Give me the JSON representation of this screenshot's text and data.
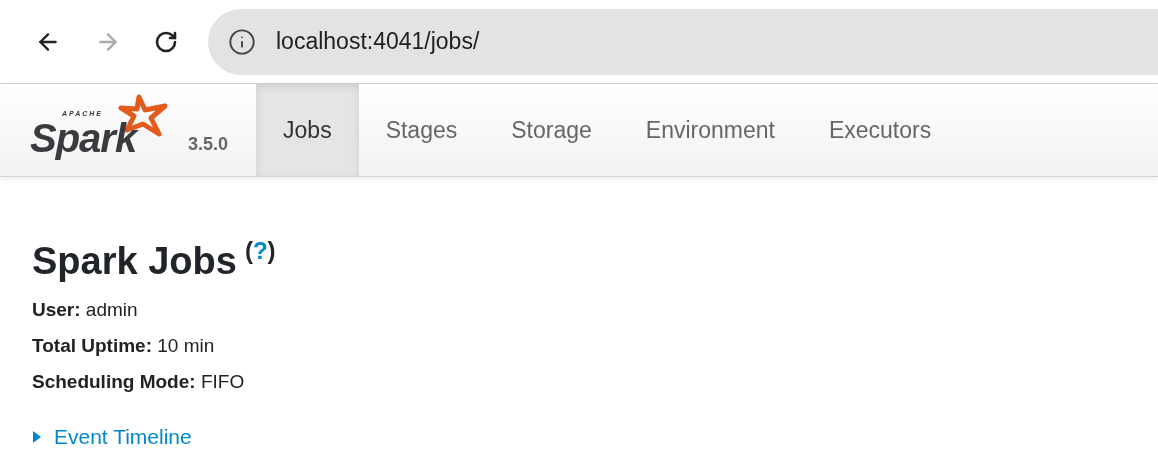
{
  "browser": {
    "url": "localhost:4041/jobs/",
    "forward_disabled": true
  },
  "navbar": {
    "logo": {
      "small": "APACHE",
      "word": "Spark"
    },
    "version": "3.5.0",
    "tabs": [
      {
        "label": "Jobs",
        "selected": true
      },
      {
        "label": "Stages",
        "selected": false
      },
      {
        "label": "Storage",
        "selected": false
      },
      {
        "label": "Environment",
        "selected": false
      },
      {
        "label": "Executors",
        "selected": false
      }
    ]
  },
  "heading": {
    "title": "Spark Jobs",
    "help_open": "(",
    "help_link": "?",
    "help_close": ")"
  },
  "info": [
    "**User:** admin",
    "**Total Uptime:** 10 min",
    "**Scheduling Mode:** FIFO"
  ],
  "event_timeline": {
    "label": "Event Timeline",
    "expanded": false
  }
}
